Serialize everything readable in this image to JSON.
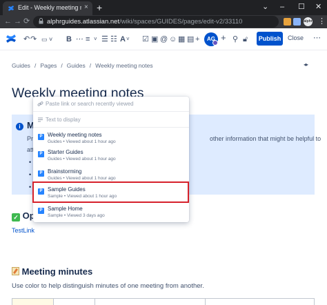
{
  "browser": {
    "tab_title": "Edit - Weekly meeting notes - G",
    "tab_close": "×",
    "new_tab": "+",
    "url_host": "alphrguides.atlassian.net",
    "url_path": "/wiki/spaces/GUIDES/pages/edit-v2/33110",
    "profile": "alphr",
    "window_controls": [
      "⌄",
      "–",
      "☐",
      "✕"
    ]
  },
  "editor": {
    "avatar_initials": "AG",
    "publish_label": "Publish",
    "close_label": "Close"
  },
  "breadcrumb": [
    "Guides",
    "Pages",
    "Guides",
    "Weekly meeting notes"
  ],
  "page": {
    "title": "Weekly meeting notes",
    "info_heading": "M",
    "info_line_left": "Pr",
    "info_line_right": "other information that might be helpful to",
    "info_line2_left": "att",
    "section_optional": "Op",
    "testlink": "TestLink",
    "section_minutes": "Meeting minutes",
    "minutes_text": "Use color to help distinguish minutes of one meeting from another."
  },
  "link_popup": {
    "url_placeholder": "Paste link or search recently viewed",
    "display_placeholder": "Text to display",
    "results": [
      {
        "title": "Weekly meeting notes",
        "space": "Guides",
        "viewed": "Viewed about 1 hour ago"
      },
      {
        "title": "Starter Guides",
        "space": "Guides",
        "viewed": "Viewed about 1 hour ago"
      },
      {
        "title": "Brainstorming",
        "space": "Guides",
        "viewed": "Viewed about 1 hour ago"
      },
      {
        "title": "Sample Guides",
        "space": "Sample",
        "viewed": "Viewed about 1 hour ago"
      },
      {
        "title": "Sample Home",
        "space": "Sample",
        "viewed": "Viewed 3 days ago"
      }
    ]
  },
  "colors": {
    "accent": "#0052cc",
    "info_panel": "#deebff",
    "highlight": "#d6202a"
  }
}
